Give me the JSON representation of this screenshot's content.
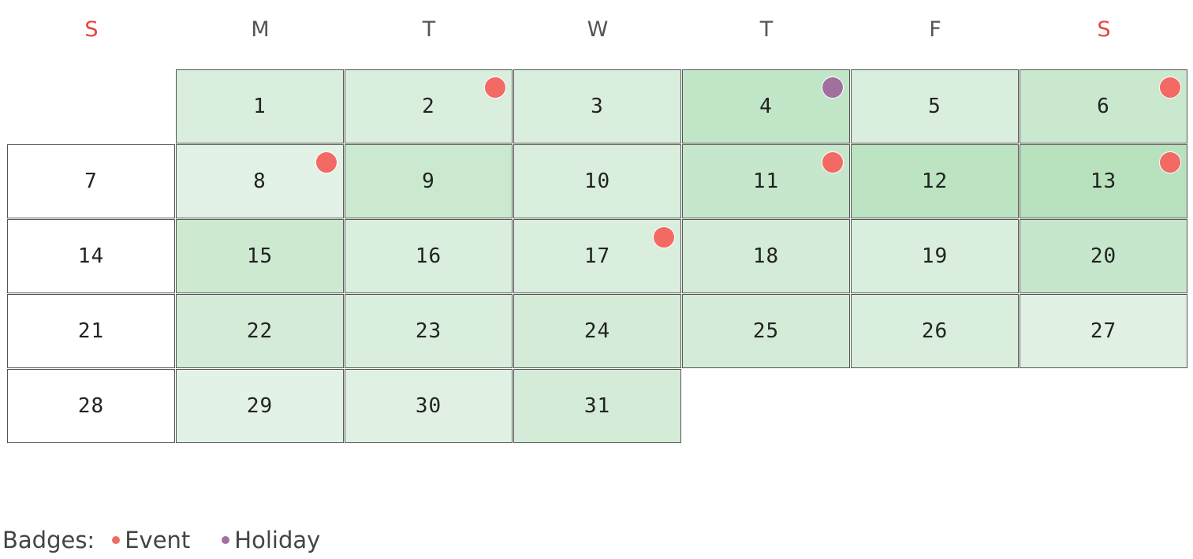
{
  "weekday_headers": [
    {
      "label": "S",
      "weekend": true
    },
    {
      "label": "M",
      "weekend": false
    },
    {
      "label": "T",
      "weekend": false
    },
    {
      "label": "W",
      "weekend": false
    },
    {
      "label": "T",
      "weekend": false
    },
    {
      "label": "F",
      "weekend": false
    },
    {
      "label": "S",
      "weekend": true
    }
  ],
  "first_weekday_index": 1,
  "days": [
    {
      "day": "1",
      "fill": "#d9eedc",
      "badge": null
    },
    {
      "day": "2",
      "fill": "#d9eedc",
      "badge": "event"
    },
    {
      "day": "3",
      "fill": "#d9eedc",
      "badge": null
    },
    {
      "day": "4",
      "fill": "#c1e5c7",
      "badge": "holiday"
    },
    {
      "day": "5",
      "fill": "#d9eedc",
      "badge": null
    },
    {
      "day": "6",
      "fill": "#c9e8ce",
      "badge": "event"
    },
    {
      "day": "7",
      "fill": "#ffffff",
      "badge": null
    },
    {
      "day": "8",
      "fill": "#e3f2e6",
      "badge": "event"
    },
    {
      "day": "9",
      "fill": "#cbe9cf",
      "badge": null
    },
    {
      "day": "10",
      "fill": "#d9eedc",
      "badge": null
    },
    {
      "day": "11",
      "fill": "#c6e7cb",
      "badge": "event"
    },
    {
      "day": "12",
      "fill": "#bce3c2",
      "badge": null
    },
    {
      "day": "13",
      "fill": "#b8e1be",
      "badge": "event"
    },
    {
      "day": "14",
      "fill": "#ffffff",
      "badge": null
    },
    {
      "day": "15",
      "fill": "#cdead1",
      "badge": null
    },
    {
      "day": "16",
      "fill": "#d9eedc",
      "badge": null
    },
    {
      "day": "17",
      "fill": "#d9eedc",
      "badge": "event"
    },
    {
      "day": "18",
      "fill": "#d4ecd7",
      "badge": null
    },
    {
      "day": "19",
      "fill": "#d9eedc",
      "badge": null
    },
    {
      "day": "20",
      "fill": "#c6e7cb",
      "badge": null
    },
    {
      "day": "21",
      "fill": "#ffffff",
      "badge": null
    },
    {
      "day": "22",
      "fill": "#d4ecd7",
      "badge": null
    },
    {
      "day": "23",
      "fill": "#d9eedc",
      "badge": null
    },
    {
      "day": "24",
      "fill": "#d4ecd7",
      "badge": null
    },
    {
      "day": "25",
      "fill": "#d4ecd7",
      "badge": null
    },
    {
      "day": "26",
      "fill": "#d9eedc",
      "badge": null
    },
    {
      "day": "27",
      "fill": "#e0f1e3",
      "badge": null
    },
    {
      "day": "28",
      "fill": "#ffffff",
      "badge": null
    },
    {
      "day": "29",
      "fill": "#e3f2e6",
      "badge": null
    },
    {
      "day": "30",
      "fill": "#e0f1e3",
      "badge": null
    },
    {
      "day": "31",
      "fill": "#d4ecd7",
      "badge": null
    }
  ],
  "badge_colors": {
    "event": "#f26a63",
    "holiday": "#a2709f"
  },
  "colors": {
    "weekend_header": "#e8453c",
    "weekday_header": "#555555",
    "cell_border": "#555555"
  },
  "legend": {
    "label": "Badges:",
    "items": [
      {
        "type": "event",
        "label": "Event"
      },
      {
        "type": "holiday",
        "label": "Holiday"
      }
    ]
  }
}
